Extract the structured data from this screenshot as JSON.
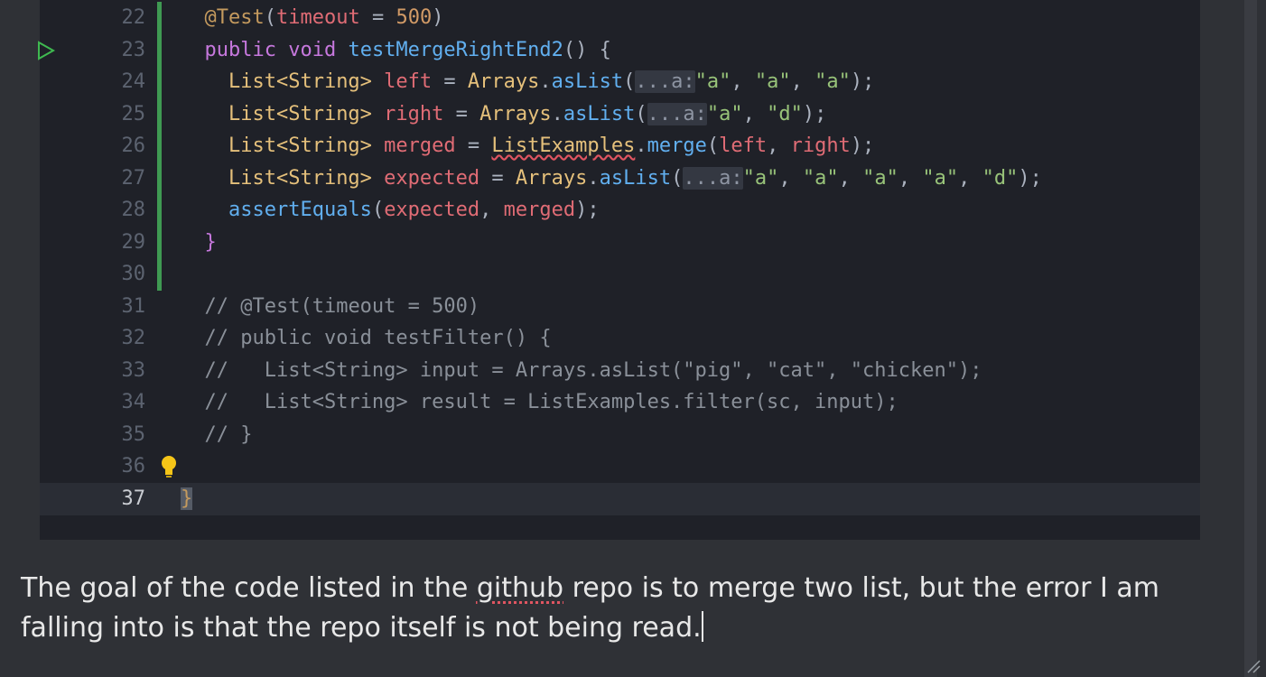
{
  "editor": {
    "lines": [
      {
        "num": "22",
        "parts": [
          [
            "ann",
            "@Test"
          ],
          [
            "pun",
            "("
          ],
          [
            "var",
            "timeout"
          ],
          [
            "pun",
            " = "
          ],
          [
            "num",
            "500"
          ],
          [
            "pun",
            ")"
          ]
        ],
        "indent": "  "
      },
      {
        "num": "23",
        "parts": [
          [
            "kw",
            "public void "
          ],
          [
            "fn",
            "testMergeRightEnd2"
          ],
          [
            "pun",
            "() {"
          ]
        ],
        "indent": "  "
      },
      {
        "num": "24",
        "parts": [
          [
            "ty",
            "List<String> "
          ],
          [
            "var",
            "left"
          ],
          [
            "pun",
            " = "
          ],
          [
            "ty",
            "Arrays"
          ],
          [
            "pun",
            "."
          ],
          [
            "fn",
            "asList"
          ],
          [
            "pun",
            "("
          ],
          [
            "hint",
            "...a:"
          ],
          [
            "str",
            "\"a\""
          ],
          [
            "pun",
            ", "
          ],
          [
            "str",
            "\"a\""
          ],
          [
            "pun",
            ", "
          ],
          [
            "str",
            "\"a\""
          ],
          [
            "pun",
            ");"
          ]
        ],
        "indent": "    "
      },
      {
        "num": "25",
        "parts": [
          [
            "ty",
            "List<String> "
          ],
          [
            "var",
            "right"
          ],
          [
            "pun",
            " = "
          ],
          [
            "ty",
            "Arrays"
          ],
          [
            "pun",
            "."
          ],
          [
            "fn",
            "asList"
          ],
          [
            "pun",
            "("
          ],
          [
            "hint",
            "...a:"
          ],
          [
            "str",
            "\"a\""
          ],
          [
            "pun",
            ", "
          ],
          [
            "str",
            "\"d\""
          ],
          [
            "pun",
            ");"
          ]
        ],
        "indent": "    "
      },
      {
        "num": "26",
        "parts": [
          [
            "ty",
            "List<String> "
          ],
          [
            "var",
            "merged"
          ],
          [
            "pun",
            " = "
          ],
          [
            "tysq",
            "ListExamples"
          ],
          [
            "pun",
            "."
          ],
          [
            "fn",
            "merge"
          ],
          [
            "pun",
            "("
          ],
          [
            "var",
            "left"
          ],
          [
            "pun",
            ", "
          ],
          [
            "var",
            "right"
          ],
          [
            "pun",
            ");"
          ]
        ],
        "indent": "    "
      },
      {
        "num": "27",
        "parts": [
          [
            "ty",
            "List<String> "
          ],
          [
            "var",
            "expected"
          ],
          [
            "pun",
            " = "
          ],
          [
            "ty",
            "Arrays"
          ],
          [
            "pun",
            "."
          ],
          [
            "fn",
            "asList"
          ],
          [
            "pun",
            "("
          ],
          [
            "hint",
            "...a:"
          ],
          [
            "str",
            "\"a\""
          ],
          [
            "pun",
            ", "
          ],
          [
            "str",
            "\"a\""
          ],
          [
            "pun",
            ", "
          ],
          [
            "str",
            "\"a\""
          ],
          [
            "pun",
            ", "
          ],
          [
            "str",
            "\"a\""
          ],
          [
            "pun",
            ", "
          ],
          [
            "str",
            "\"d\""
          ],
          [
            "pun",
            ");"
          ]
        ],
        "indent": "    "
      },
      {
        "num": "28",
        "parts": [
          [
            "fn",
            "assertEquals"
          ],
          [
            "pun",
            "("
          ],
          [
            "var",
            "expected"
          ],
          [
            "pun",
            ", "
          ],
          [
            "var",
            "merged"
          ],
          [
            "pun",
            ");"
          ]
        ],
        "indent": "    "
      },
      {
        "num": "29",
        "parts": [
          [
            "kw",
            "}"
          ]
        ],
        "indent": "  "
      },
      {
        "num": "30",
        "parts": [],
        "indent": ""
      },
      {
        "num": "31",
        "parts": [
          [
            "cmt",
            "// @Test(timeout = 500)"
          ]
        ],
        "indent": "  "
      },
      {
        "num": "32",
        "parts": [
          [
            "cmt",
            "// public void testFilter() {"
          ]
        ],
        "indent": "  "
      },
      {
        "num": "33",
        "parts": [
          [
            "cmt",
            "//   List<String> input = Arrays.asList(\"pig\", \"cat\", \"chicken\");"
          ]
        ],
        "indent": "  "
      },
      {
        "num": "34",
        "parts": [
          [
            "cmt",
            "//   List<String> result = ListExamples.filter(sc, input);"
          ]
        ],
        "indent": "  "
      },
      {
        "num": "35",
        "parts": [
          [
            "cmt",
            "// }"
          ]
        ],
        "indent": "  "
      },
      {
        "num": "36",
        "parts": [],
        "indent": ""
      },
      {
        "num": "37",
        "parts": [
          [
            "bracecur",
            "}"
          ]
        ],
        "indent": ""
      }
    ],
    "run_icon": "run-triangle-icon",
    "bulb_icon": "lightbulb-icon"
  },
  "prose": {
    "before": "The goal of the code listed in the ",
    "misspelled": "github",
    "after": " repo is to merge two list, but the error I am falling into is that the repo itself is not being read."
  }
}
